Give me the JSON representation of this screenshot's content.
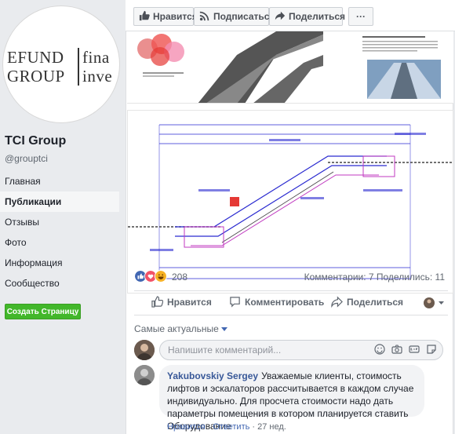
{
  "sidebar": {
    "logo": {
      "top_left": "EFUND",
      "top_right": "fina",
      "bottom_left": "GROUP",
      "bottom_right": "inve"
    },
    "page_name": "TCI Group",
    "handle": "@grouptci",
    "nav": [
      "Главная",
      "Публикации",
      "Отзывы",
      "Фото",
      "Информация",
      "Сообщество"
    ],
    "active_nav": "Публикации",
    "create_page": "Создать Страницу"
  },
  "topbar": {
    "like": "Нравится",
    "follow": "Подписаться",
    "share": "Поделиться",
    "more": "···"
  },
  "post": {
    "reactions_count": "208",
    "stats": "Комментарии: 7  Поделились: 11",
    "actions": {
      "like": "Нравится",
      "comment": "Комментировать",
      "share": "Поделиться"
    },
    "sort_label": "Самые актуальные",
    "comment_placeholder": "Напишите комментарий...",
    "comments": [
      {
        "author": "Yakubovskiy Sergey",
        "text": "Уважаемые клиенты, стоимость лифтов и эскалаторов рассчитывается в каждом случае индивидуально. Для просчета стоимости надо дать параметры помещения в котором планируется ставить Оборудование",
        "like": "Нравится",
        "sep": " · ",
        "reply": "Ответить",
        "time": "27 нед."
      }
    ]
  },
  "colors": {
    "accent": "#4267b2",
    "create_button": "#42b72a",
    "link": "#385898"
  }
}
